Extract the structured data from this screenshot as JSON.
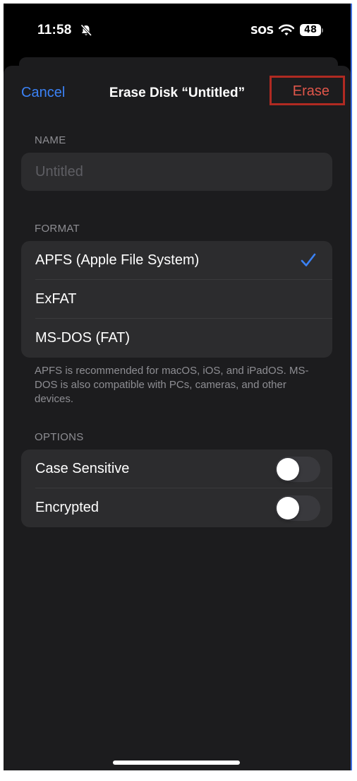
{
  "status_bar": {
    "time": "11:58",
    "carrier": "SOS",
    "battery": "48"
  },
  "nav": {
    "cancel_label": "Cancel",
    "title": "Erase Disk “Untitled”",
    "erase_label": "Erase"
  },
  "name_section": {
    "header": "NAME",
    "placeholder": "Untitled",
    "value": ""
  },
  "format_section": {
    "header": "FORMAT",
    "options": [
      {
        "label": "APFS (Apple File System)",
        "selected": true
      },
      {
        "label": "ExFAT",
        "selected": false
      },
      {
        "label": "MS-DOS (FAT)",
        "selected": false
      }
    ],
    "footer": "APFS is recommended for macOS, iOS, and iPadOS. MS-DOS is also compatible with PCs, cameras, and other devices."
  },
  "options_section": {
    "header": "OPTIONS",
    "items": [
      {
        "label": "Case Sensitive",
        "enabled": false
      },
      {
        "label": "Encrypted",
        "enabled": false
      }
    ]
  },
  "colors": {
    "accent": "#3b82f6",
    "destructive": "#e0564a",
    "highlight_box": "#b02a22",
    "background": "#1c1c1e",
    "cell": "#2c2c2e"
  }
}
